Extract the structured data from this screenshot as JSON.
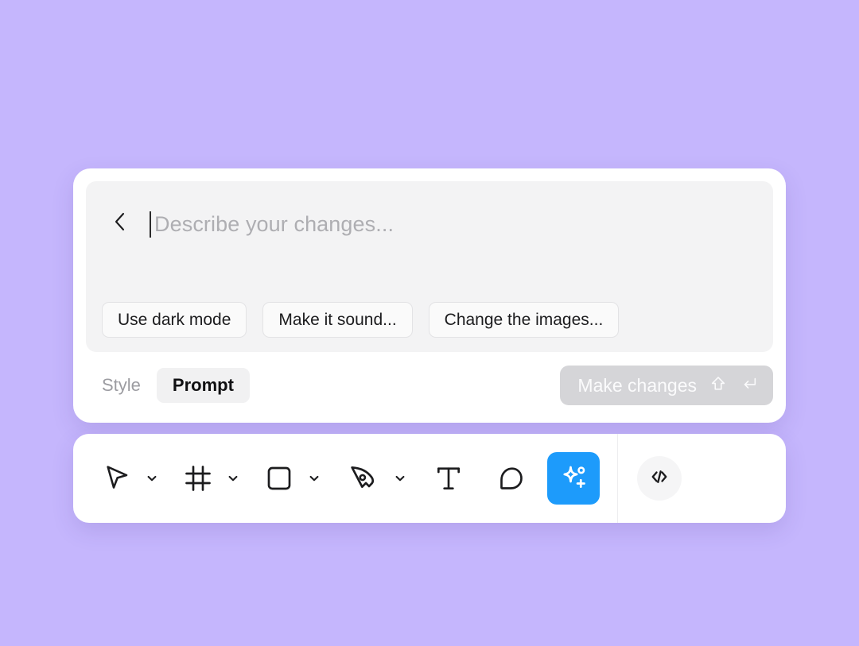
{
  "canvas": {
    "background_color": "#C5B6FD"
  },
  "ai_card": {
    "back_button_icon": "chevron-left-icon",
    "input": {
      "value": "",
      "placeholder": "Describe your changes...",
      "caret_visible": true
    },
    "suggestion_chips": [
      {
        "label": "Use dark mode"
      },
      {
        "label": "Make it sound..."
      },
      {
        "label": "Change the images..."
      }
    ],
    "tabs": [
      {
        "label": "Style",
        "active": false
      },
      {
        "label": "Prompt",
        "active": true
      }
    ],
    "submit": {
      "label": "Make changes",
      "enabled": false,
      "shortcut_icons": [
        "shift-key-icon",
        "enter-key-icon"
      ],
      "background_color": "#D5D5D8"
    }
  },
  "toolbar": {
    "tools": [
      {
        "name": "move-tool",
        "icon": "cursor-arrow-icon",
        "has_dropdown": true,
        "active": false
      },
      {
        "name": "frame-tool",
        "icon": "frame-icon",
        "has_dropdown": true,
        "active": false
      },
      {
        "name": "shape-tool",
        "icon": "square-icon",
        "has_dropdown": true,
        "active": false
      },
      {
        "name": "pen-tool",
        "icon": "pen-icon",
        "has_dropdown": true,
        "active": false
      },
      {
        "name": "text-tool",
        "icon": "text-t-icon",
        "has_dropdown": false,
        "active": false
      },
      {
        "name": "comment-tool",
        "icon": "comment-bubble-icon",
        "has_dropdown": false,
        "active": false
      },
      {
        "name": "ai-tool",
        "icon": "sparkle-plus-icon",
        "has_dropdown": false,
        "active": true
      }
    ],
    "ai_button_color": "#1D9BFB",
    "dev_mode": {
      "name": "dev-mode-button",
      "icon": "code-brackets-icon"
    }
  }
}
